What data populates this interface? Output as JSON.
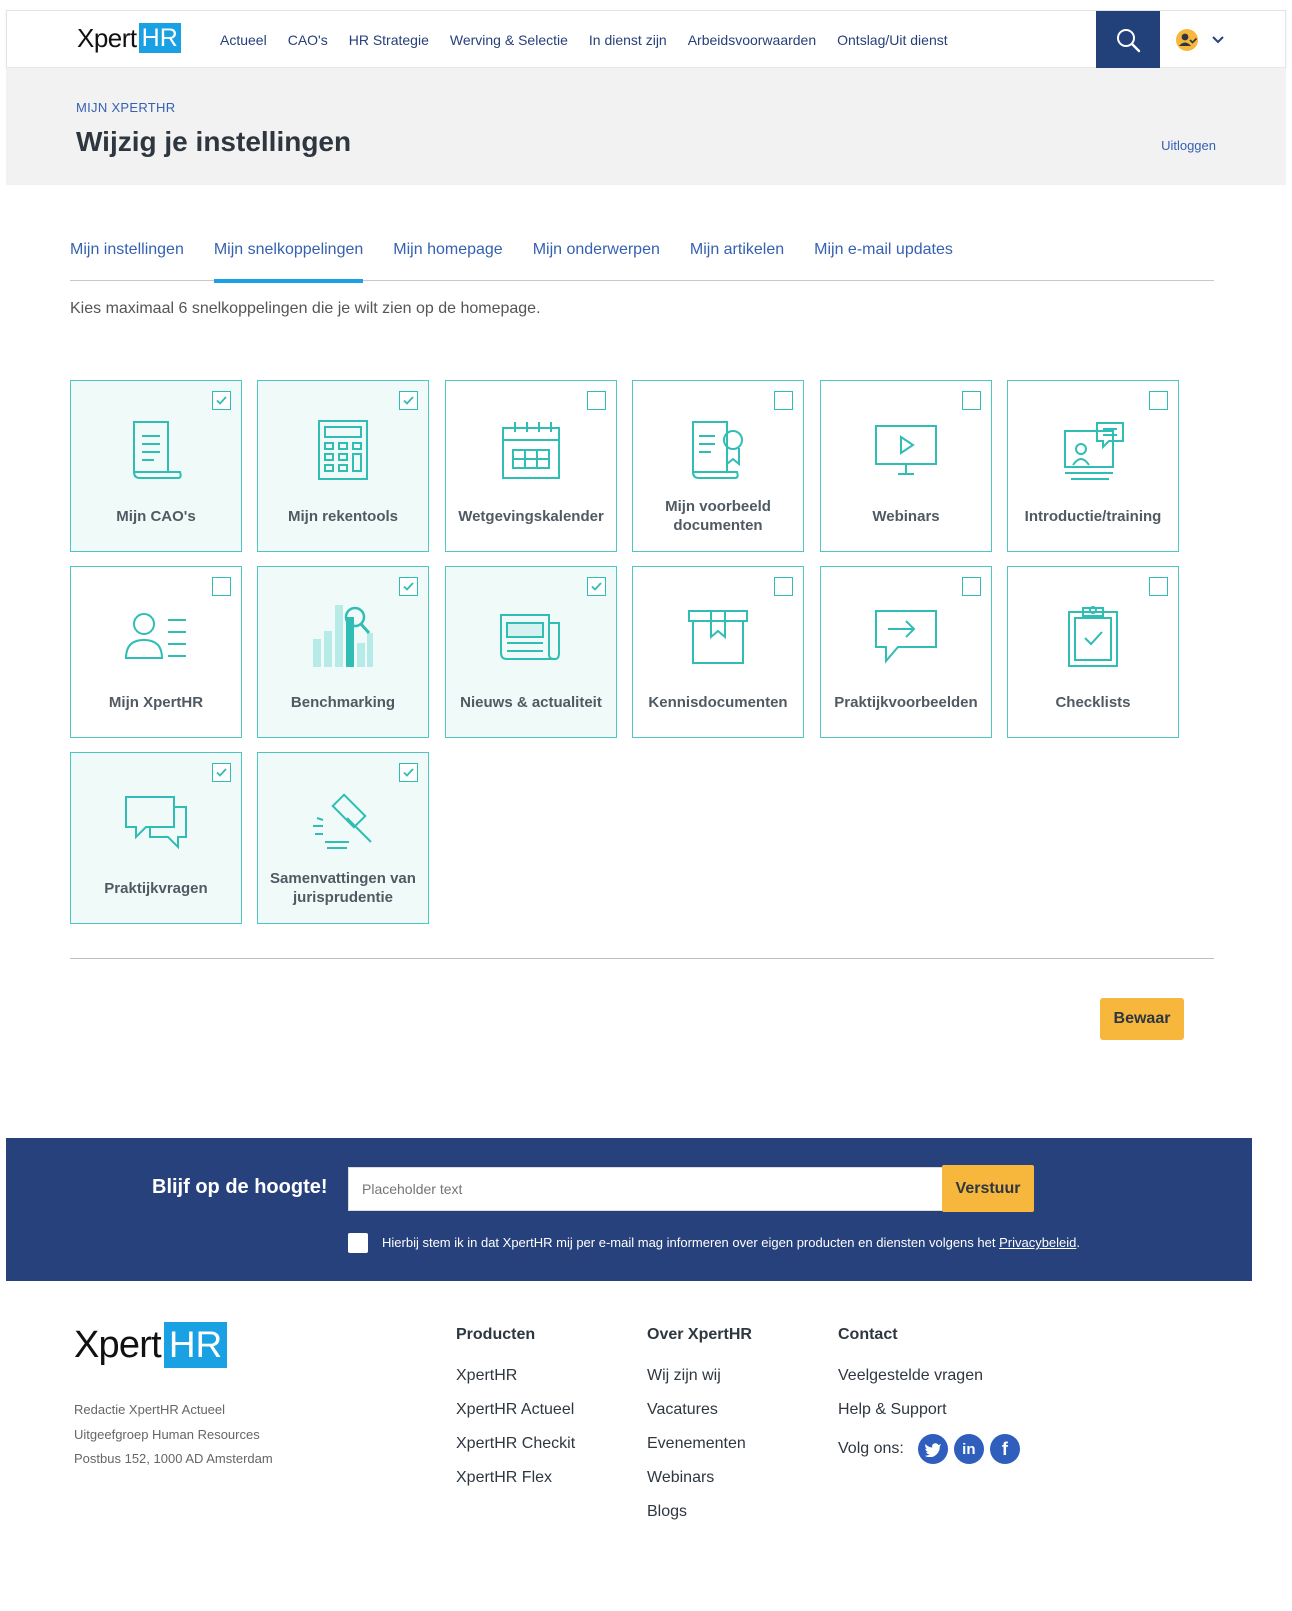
{
  "header": {
    "logo_text": "Xpert",
    "logo_badge": "HR",
    "nav": [
      "Actueel",
      "CAO's",
      "HR Strategie",
      "Werving & Selectie",
      "In dienst zijn",
      "Arbeidsvoorwaarden",
      "Ontslag/Uit dienst"
    ],
    "search_icon": "search-icon",
    "user_icon": "user-icon"
  },
  "title_band": {
    "breadcrumb": "MIJN XPERTHR",
    "title": "Wijzig je instellingen",
    "logout": "Uitloggen"
  },
  "tabs": [
    {
      "label": "Mijn instellingen",
      "active": false
    },
    {
      "label": "Mijn snelkoppelingen",
      "active": true
    },
    {
      "label": "Mijn homepage",
      "active": false
    },
    {
      "label": "Mijn onderwerpen",
      "active": false
    },
    {
      "label": "Mijn artikelen",
      "active": false
    },
    {
      "label": "Mijn e-mail updates",
      "active": false
    }
  ],
  "intro": "Kies maximaal 6 snelkoppelingen die je wilt zien op de homepage.",
  "tiles": [
    {
      "label": "Mijn CAO's",
      "icon": "document-icon",
      "checked": true
    },
    {
      "label": "Mijn rekentools",
      "icon": "calculator-icon",
      "checked": true
    },
    {
      "label": "Wetgevingskalender",
      "icon": "calendar-icon",
      "checked": false
    },
    {
      "label": "Mijn voorbeeld documenten",
      "icon": "certificate-icon",
      "checked": false
    },
    {
      "label": "Webinars",
      "icon": "video-icon",
      "checked": false
    },
    {
      "label": "Introductie/training",
      "icon": "training-icon",
      "checked": false
    },
    {
      "label": "Mijn XpertHR",
      "icon": "profile-icon",
      "checked": false
    },
    {
      "label": "Benchmarking",
      "icon": "bar-chart-icon",
      "checked": true
    },
    {
      "label": "Nieuws & actualiteit",
      "icon": "newspaper-icon",
      "checked": true
    },
    {
      "label": "Kennisdocumenten",
      "icon": "archive-box-icon",
      "checked": false
    },
    {
      "label": "Praktijkvoorbeelden",
      "icon": "speech-arrow-icon",
      "checked": false
    },
    {
      "label": "Checklists",
      "icon": "clipboard-check-icon",
      "checked": false
    },
    {
      "label": "Praktijkvragen",
      "icon": "chat-bubbles-icon",
      "checked": true
    },
    {
      "label": "Samenvattingen van jurisprudentie",
      "icon": "gavel-icon",
      "checked": true
    }
  ],
  "save_label": "Bewaar",
  "newsletter": {
    "title": "Blijf op de hoogte!",
    "placeholder": "Placeholder text",
    "button": "Verstuur",
    "consent_text": "Hierbij stem ik in dat XpertHR mij per e-mail mag informeren over eigen producten en diensten volgens het ",
    "consent_link": "Privacybeleid",
    "consent_end": "."
  },
  "footer": {
    "logo_text": "Xpert",
    "logo_badge": "HR",
    "address": [
      "Redactie XpertHR Actueel",
      "Uitgeefgroep Human Resources",
      "Postbus 152, 1000 AD Amsterdam"
    ],
    "columns": [
      {
        "title": "Producten",
        "links": [
          "XpertHR",
          "XpertHR Actueel",
          "XpertHR Checkit",
          "XpertHR Flex"
        ]
      },
      {
        "title": "Over XpertHR",
        "links": [
          "Wij zijn wij",
          "Vacatures",
          "Evenementen",
          "Webinars",
          "Blogs"
        ]
      },
      {
        "title": "Contact",
        "links": [
          "Veelgestelde vragen",
          "Help & Support"
        ]
      }
    ],
    "follow_label": "Volg ons:",
    "social": [
      "twitter-icon",
      "linkedin-icon",
      "facebook-icon"
    ]
  },
  "colors": {
    "accent": "#1aa1e3",
    "teal": "#30bdb3",
    "navy": "#26417b",
    "button": "#f6b73c"
  }
}
